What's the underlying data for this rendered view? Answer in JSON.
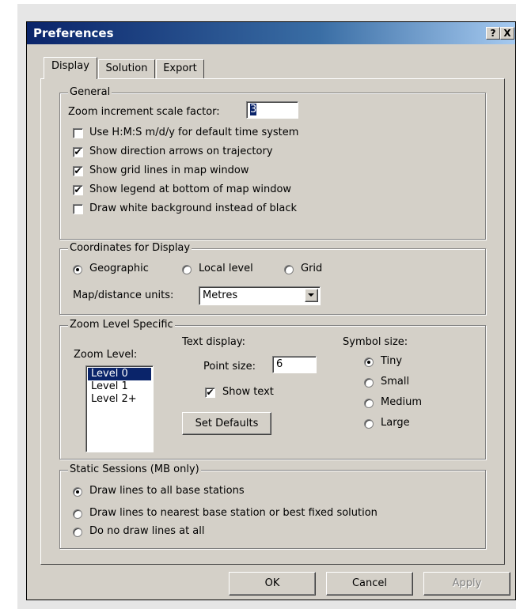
{
  "window": {
    "title": "Preferences",
    "help_label": "?",
    "close_label": "X"
  },
  "tabs": [
    "Display",
    "Solution",
    "Export"
  ],
  "general": {
    "title": "General",
    "zoom_label": "Zoom increment scale factor:",
    "zoom_value": "3",
    "checkboxes": [
      {
        "label": "Use H:M:S m/d/y for default time system",
        "checked": false
      },
      {
        "label": "Show direction arrows on trajectory",
        "checked": true
      },
      {
        "label": "Show grid lines in map window",
        "checked": true
      },
      {
        "label": "Show legend at bottom of map window",
        "checked": true
      },
      {
        "label": "Draw white background instead of black",
        "checked": false
      }
    ]
  },
  "coordinates": {
    "title": "Coordinates for Display",
    "options": [
      {
        "label": "Geographic",
        "selected": true
      },
      {
        "label": "Local level",
        "selected": false
      },
      {
        "label": "Grid",
        "selected": false
      }
    ],
    "units_label": "Map/distance units:",
    "units_value": "Metres"
  },
  "zoom_specific": {
    "title": "Zoom Level Specific",
    "zoom_level_label": "Zoom Level:",
    "levels": [
      {
        "label": "Level 0",
        "selected": true
      },
      {
        "label": "Level 1",
        "selected": false
      },
      {
        "label": "Level 2+",
        "selected": false
      }
    ],
    "text_display_label": "Text display:",
    "point_size_label": "Point size:",
    "point_size_value": "6",
    "show_text_label": "Show text",
    "show_text_checked": true,
    "set_defaults_label": "Set Defaults",
    "symbol_size_label": "Symbol size:",
    "symbol_sizes": [
      {
        "label": "Tiny",
        "selected": true
      },
      {
        "label": "Small",
        "selected": false
      },
      {
        "label": "Medium",
        "selected": false
      },
      {
        "label": "Large",
        "selected": false
      }
    ]
  },
  "static_sessions": {
    "title": "Static Sessions (MB only)",
    "options": [
      {
        "label": "Draw lines to all base stations",
        "selected": true
      },
      {
        "label": "Draw lines to nearest base station or best fixed solution",
        "selected": false
      },
      {
        "label": "Do no draw lines at all",
        "selected": false
      }
    ]
  },
  "buttons": {
    "ok": "OK",
    "cancel": "Cancel",
    "apply": "Apply"
  }
}
